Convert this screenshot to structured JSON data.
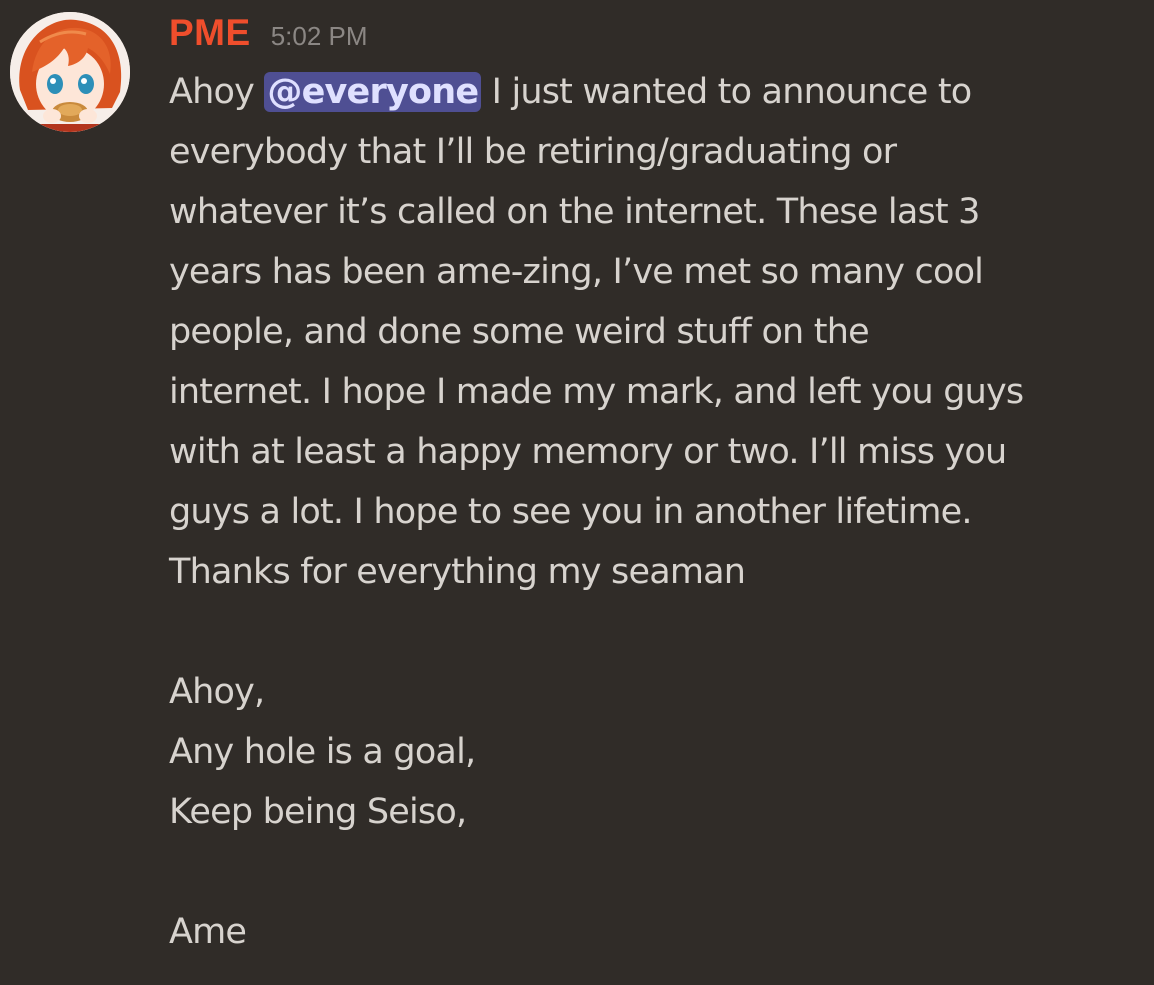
{
  "message": {
    "author": "PME",
    "timestamp": "5:02 PM",
    "avatar_icon": "anime-girl-avatar-icon",
    "mention": "@everyone",
    "colors": {
      "background": "#302c28",
      "username": "#ef4e2c",
      "timestamp": "#8b8784",
      "text": "#d7d3ce",
      "mention_bg": "#4f4f93"
    },
    "lines": [
      "Ahoy",
      "I just wanted to announce to",
      "everybody that I’ll be retiring/graduating or",
      "whatever it’s called on the internet. These last 3",
      "years has been ame-zing, I’ve met so many cool",
      "people, and done some weird stuff on the",
      "internet. I hope I made my mark, and left you guys",
      "with at least a happy memory or two. I’ll miss you",
      "guys a lot. I hope to see you in another lifetime.",
      "Thanks for everything my seaman",
      "Ahoy,",
      "Any hole is a goal,",
      "Keep being Seiso,",
      "Ame"
    ]
  }
}
